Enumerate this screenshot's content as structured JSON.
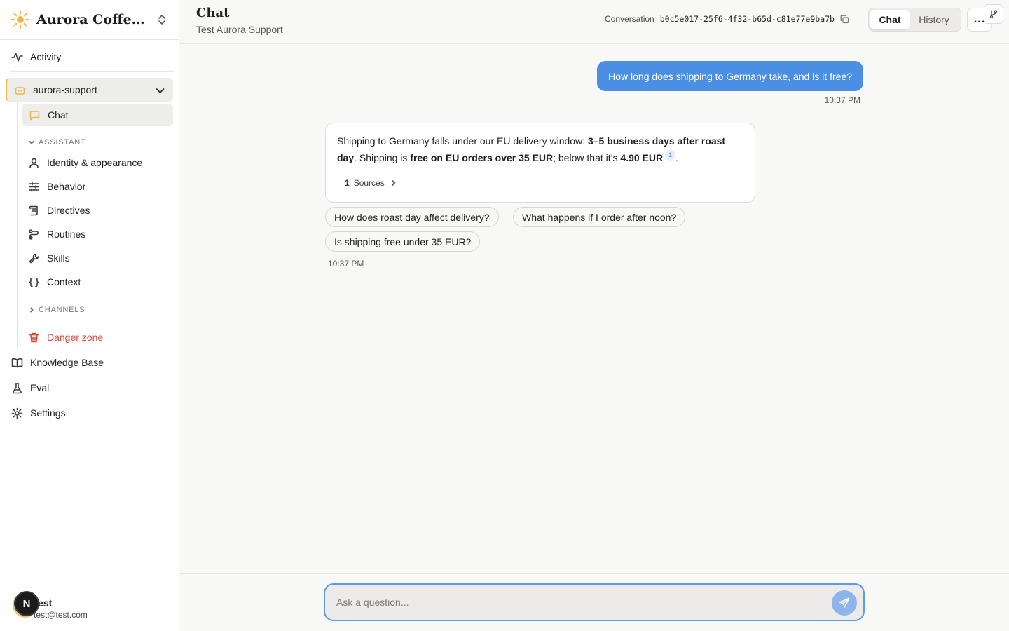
{
  "sidebar": {
    "brand_name": "Aurora Coffee R...",
    "activity_label": "Activity",
    "agent_label": "aurora-support",
    "chat_label": "Chat",
    "assistant_section": "ASSISTANT",
    "assistant_items": [
      "Identity & appearance",
      "Behavior",
      "Directives",
      "Routines",
      "Skills",
      "Context"
    ],
    "channels_section": "CHANNELS",
    "danger_label": "Danger zone",
    "knowledge_label": "Knowledge Base",
    "eval_label": "Eval",
    "settings_label": "Settings",
    "user_name": "est",
    "user_email": "test@test.com",
    "user_badge": "N",
    "brand_color": "#e9b949"
  },
  "header": {
    "title": "Chat",
    "subtitle": "Test Aurora Support",
    "conversation_label": "Conversation",
    "conversation_id": "b0c5e017-25f6-4f32-b65d-c81e77e9ba7b",
    "tab_chat": "Chat",
    "tab_history": "History",
    "more_label": "..."
  },
  "messages": {
    "user_text": "How long does shipping to Germany take, and is it free?",
    "user_time": "10:37 PM",
    "bot_part1": "Shipping to Germany falls under our EU delivery window: ",
    "bot_bold1": "3–5 business days after roast day",
    "bot_part2": ". Shipping is ",
    "bot_bold2": "free on EU orders over 35 EUR",
    "bot_part3": "; below that it’s ",
    "bot_bold3": "4.90 EUR",
    "bot_cite": "1",
    "bot_part4": ".",
    "sources_count": "1",
    "sources_label": "Sources",
    "bot_time": "10:37 PM",
    "suggestions": [
      "How does roast day affect delivery?",
      "What happens if I order after noon?",
      "Is shipping free under 35 EUR?"
    ]
  },
  "composer": {
    "placeholder": "Ask a question...",
    "accent": "#4a8fe3"
  }
}
